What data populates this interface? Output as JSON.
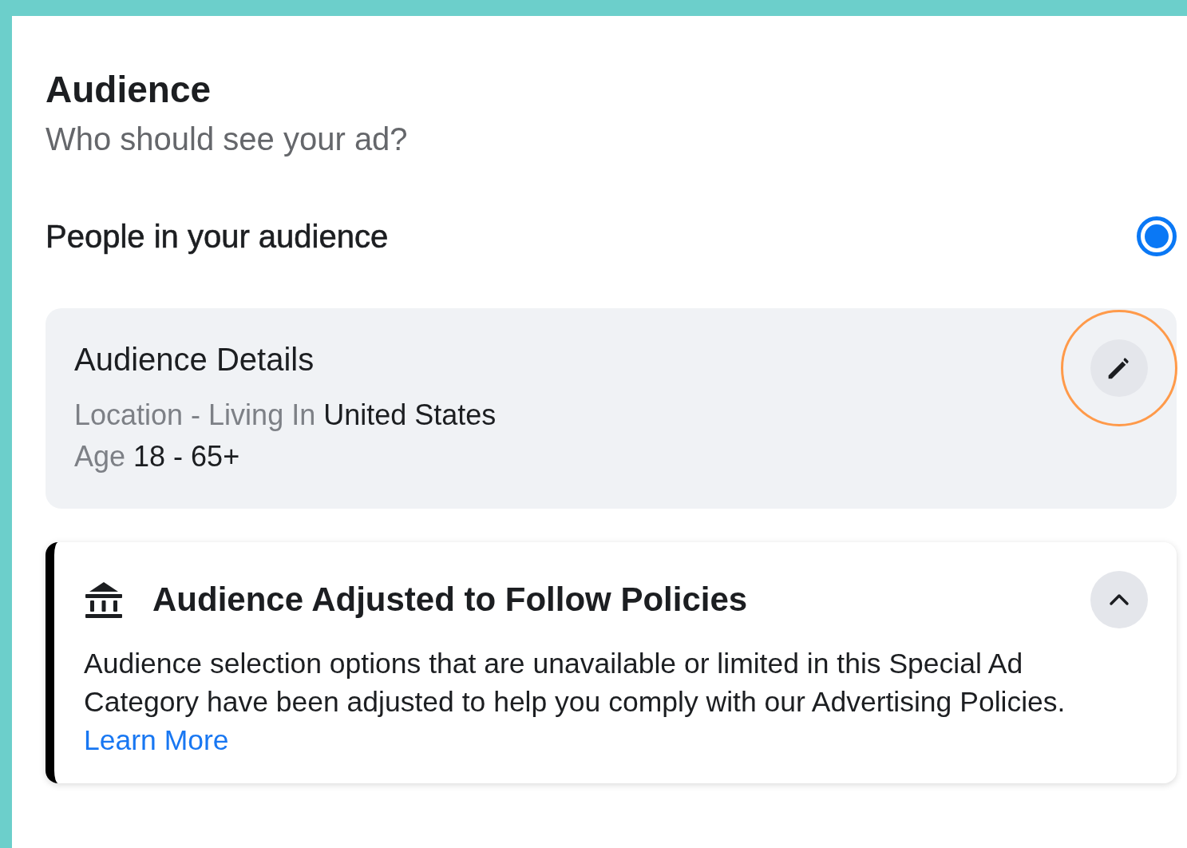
{
  "section": {
    "title": "Audience",
    "subtitle": "Who should see your ad?"
  },
  "audience_option": {
    "label": "People in your audience",
    "selected": true
  },
  "audience_details": {
    "title": "Audience Details",
    "highlighted": true,
    "rows": [
      {
        "label": "Location - Living In",
        "value": "United States"
      },
      {
        "label": "Age",
        "value": "18 - 65+"
      }
    ]
  },
  "policy_notice": {
    "title": "Audience Adjusted to Follow Policies",
    "expanded": true,
    "body": "Audience selection options that are unavailable or limited in this Special Ad Category have been adjusted to help you comply with our Advertising Policies.",
    "link": "Learn More"
  }
}
